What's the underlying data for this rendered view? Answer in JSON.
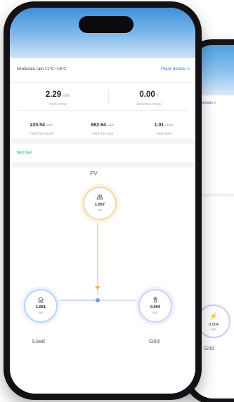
{
  "back_screen": {
    "link_partial": "ant details >",
    "node_value": "0.004",
    "node_unit": "kW",
    "grid_label": "Grid"
  },
  "header": {
    "weather": "Moderate rain 11°C~18°C",
    "plant_details": "Plant details >"
  },
  "today": {
    "yield_value": "2.29",
    "yield_unit": "kWh",
    "yield_label": "Yield today",
    "revenue_value": "0.00",
    "revenue_unit": "€",
    "revenue_label": "Revenue today"
  },
  "stats": [
    {
      "value": "225.54",
      "unit": "kWh",
      "label": "Yield this month"
    },
    {
      "value": "862.64",
      "unit": "kWh",
      "label": "Yield this year"
    },
    {
      "value": "1.01",
      "unit": "MWh",
      "label": "Total yield"
    }
  ],
  "status": "Normal",
  "flow": {
    "pv": {
      "label": "PV",
      "value": "1.057",
      "unit": "kW",
      "icon": "solar-panel-icon"
    },
    "load": {
      "label": "Load",
      "value": "1.061",
      "unit": "kW",
      "icon": "home-icon"
    },
    "grid": {
      "label": "Grid",
      "value": "0.004",
      "unit": "kW",
      "icon": "power-tower-icon"
    }
  },
  "colors": {
    "accent": "#2f7de1",
    "status_ok": "#16b39a",
    "pv_ring": "#f2d7a8",
    "load_ring": "#b9d4f6",
    "grid_ring": "#dccbf3"
  }
}
